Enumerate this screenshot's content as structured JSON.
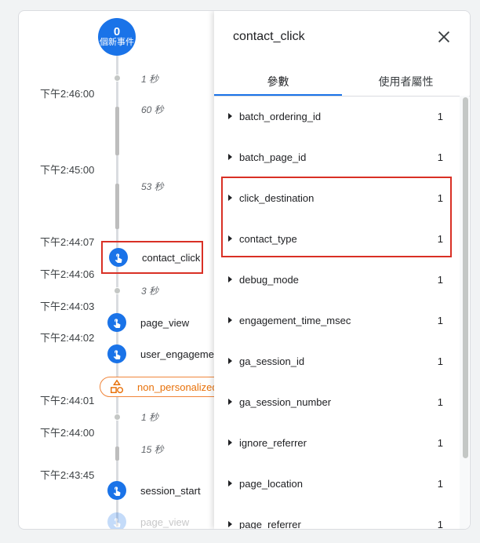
{
  "timeline": {
    "new_events_count": "0",
    "new_events_label": "個新事件",
    "times": [
      "下午2:46:00",
      "下午2:45:00",
      "下午2:44:07",
      "下午2:44:06",
      "下午2:44:03",
      "下午2:44:02",
      "下午2:44:01",
      "下午2:44:00",
      "下午2:43:45"
    ],
    "durations": [
      "1 秒",
      "60 秒",
      "53 秒",
      "3 秒",
      "1 秒",
      "15 秒"
    ],
    "events": [
      "contact_click",
      "page_view",
      "user_engagement",
      "session_start",
      "page_view"
    ],
    "non_personalized": "non_personalized_ads"
  },
  "panel": {
    "title": "contact_click",
    "tabs": [
      "參數",
      "使用者屬性"
    ],
    "params": [
      {
        "name": "batch_ordering_id",
        "value": "1"
      },
      {
        "name": "batch_page_id",
        "value": "1"
      },
      {
        "name": "click_destination",
        "value": "1"
      },
      {
        "name": "contact_type",
        "value": "1"
      },
      {
        "name": "debug_mode",
        "value": "1"
      },
      {
        "name": "engagement_time_msec",
        "value": "1"
      },
      {
        "name": "ga_session_id",
        "value": "1"
      },
      {
        "name": "ga_session_number",
        "value": "1"
      },
      {
        "name": "ignore_referrer",
        "value": "1"
      },
      {
        "name": "page_location",
        "value": "1"
      },
      {
        "name": "page_referrer",
        "value": "1"
      }
    ]
  },
  "colors": {
    "accent": "#1a73e8",
    "highlight": "#d93025",
    "np_orange": "#e8710a"
  }
}
